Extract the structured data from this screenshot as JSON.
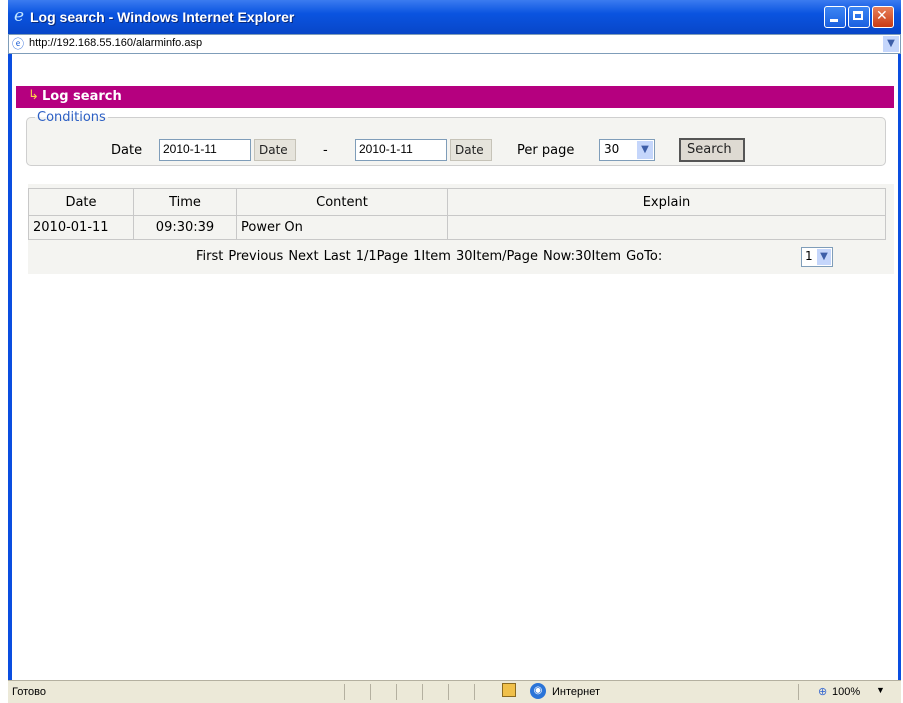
{
  "window": {
    "title": "Log search - Windows Internet Explorer",
    "url": "http://192.168.55.160/alarminfo.asp"
  },
  "header": {
    "title": "Log search"
  },
  "conditions": {
    "legend": "Conditions",
    "date_label": "Date",
    "date_from": "2010-1-11",
    "date_to": "2010-1-11",
    "date_button": "Date",
    "separator": "-",
    "per_page_label": "Per page",
    "per_page_value": "30",
    "search_button": "Search"
  },
  "table": {
    "columns": [
      "Date",
      "Time",
      "Content",
      "Explain"
    ],
    "rows": [
      [
        "2010-01-11",
        "09:30:39",
        "Power On",
        ""
      ]
    ]
  },
  "pager": {
    "first": "First",
    "previous": "Previous",
    "next": "Next",
    "last": "Last",
    "page_info": "1/1Page",
    "item_count": "1Item",
    "items_per_page": "30Item/Page",
    "now": "Now:30Item",
    "goto_label": "GoTo:",
    "goto_value": "1"
  },
  "statusbar": {
    "status": "Готово",
    "zone": "Интернет",
    "zoom": "100%"
  },
  "icons": {
    "title": "ie-icon",
    "address": "page-icon",
    "header": "arrow-icon",
    "zone": "globe-icon",
    "zoom": "zoom-icon"
  },
  "colors": {
    "header_bg": "#b5007f",
    "titlebar_bg": "#0a54e0",
    "legend": "#2c5fc4"
  }
}
